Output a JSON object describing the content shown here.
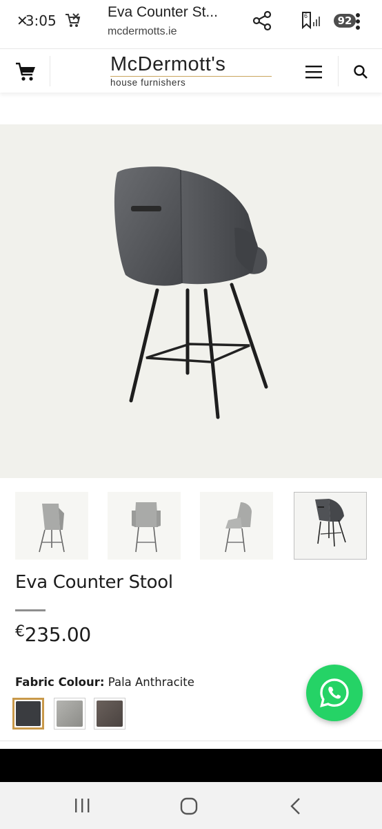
{
  "status_bar": {
    "time": "3:05",
    "battery": "92",
    "sim_badge": "6"
  },
  "browser": {
    "title": "Eva Counter St...",
    "url": "mcdermotts.ie"
  },
  "site": {
    "logo_main": "McDermott's",
    "logo_sub": "house furnishers"
  },
  "product": {
    "name": "Eva Counter Stool",
    "currency_symbol": "€",
    "price": "235.00",
    "fabric_label": "Fabric Colour:",
    "fabric_value": "Pala Anthracite",
    "swatches": [
      {
        "name": "Pala Anthracite",
        "color": "#3a3c40",
        "selected": true
      },
      {
        "name": "Light Grey",
        "color": "#9a9a96",
        "selected": false
      },
      {
        "name": "Brown",
        "color": "#5a524e",
        "selected": false
      }
    ]
  },
  "colors": {
    "accent": "#c9994a",
    "whatsapp": "#25d366",
    "nav_bg": "#f2f2f2"
  },
  "icons": [
    "cart-icon",
    "menu-icon",
    "search-icon",
    "share-icon",
    "whatsapp-icon",
    "recents-icon",
    "home-icon",
    "back-icon"
  ]
}
